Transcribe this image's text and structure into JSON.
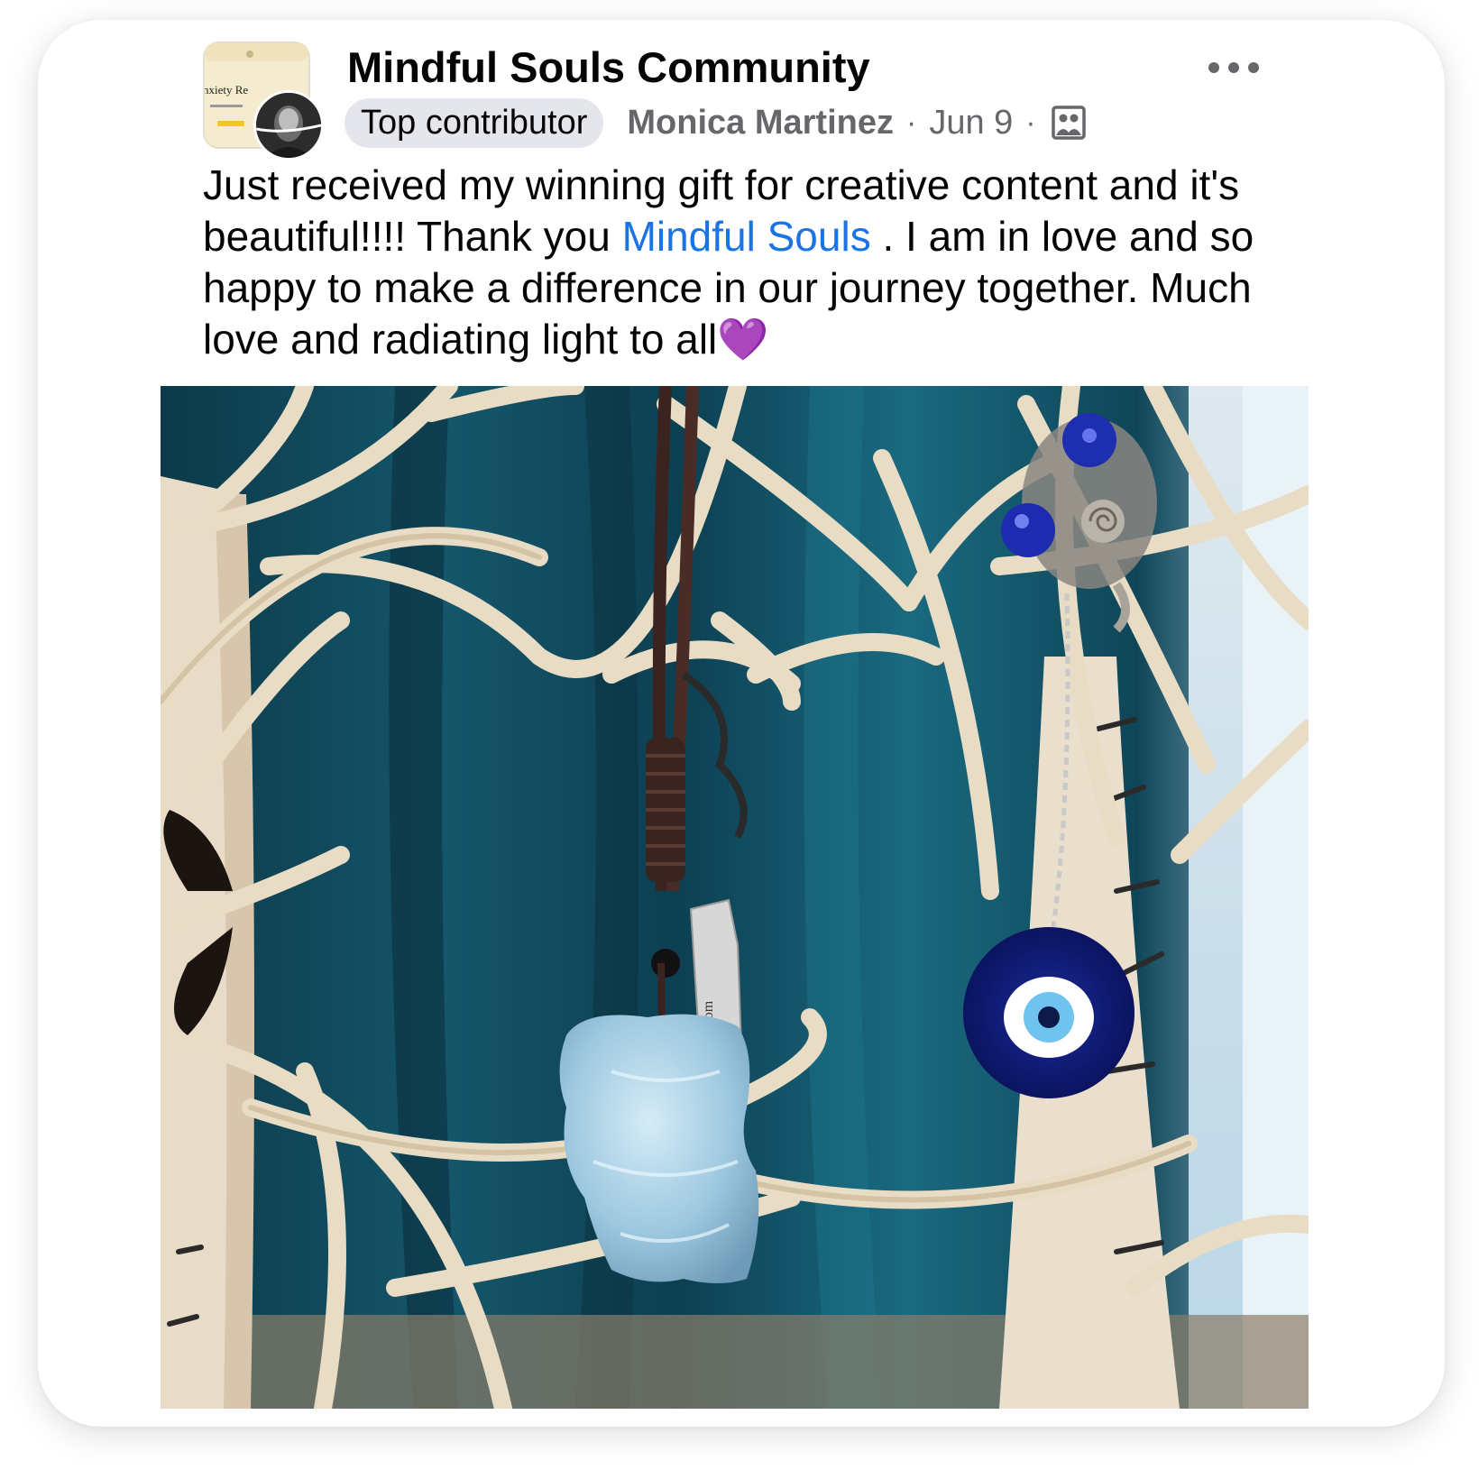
{
  "post": {
    "group_name": "Mindful Souls Community",
    "avatar_text": "nxiety Re",
    "badge": "Top contributor",
    "author": "Monica Martinez",
    "separator": "·",
    "date": "Jun 9",
    "audience_icon": "group-audience-icon",
    "more_icon": "more-options-icon",
    "text_part1": "Just received my winning gift for creative content and it's beautiful!!!! Thank you ",
    "mention": "Mindful Souls",
    "text_part2": " . I am in love and so happy to make a difference in our journey together. Much love and radiating light to all",
    "emoji": "💜",
    "pendant_tag_text": "ouls.com"
  },
  "colors": {
    "mention": "#1b74e4",
    "secondary_text": "#65676b",
    "badge_bg": "#e4e6eb",
    "heart": "#9b51e0"
  }
}
